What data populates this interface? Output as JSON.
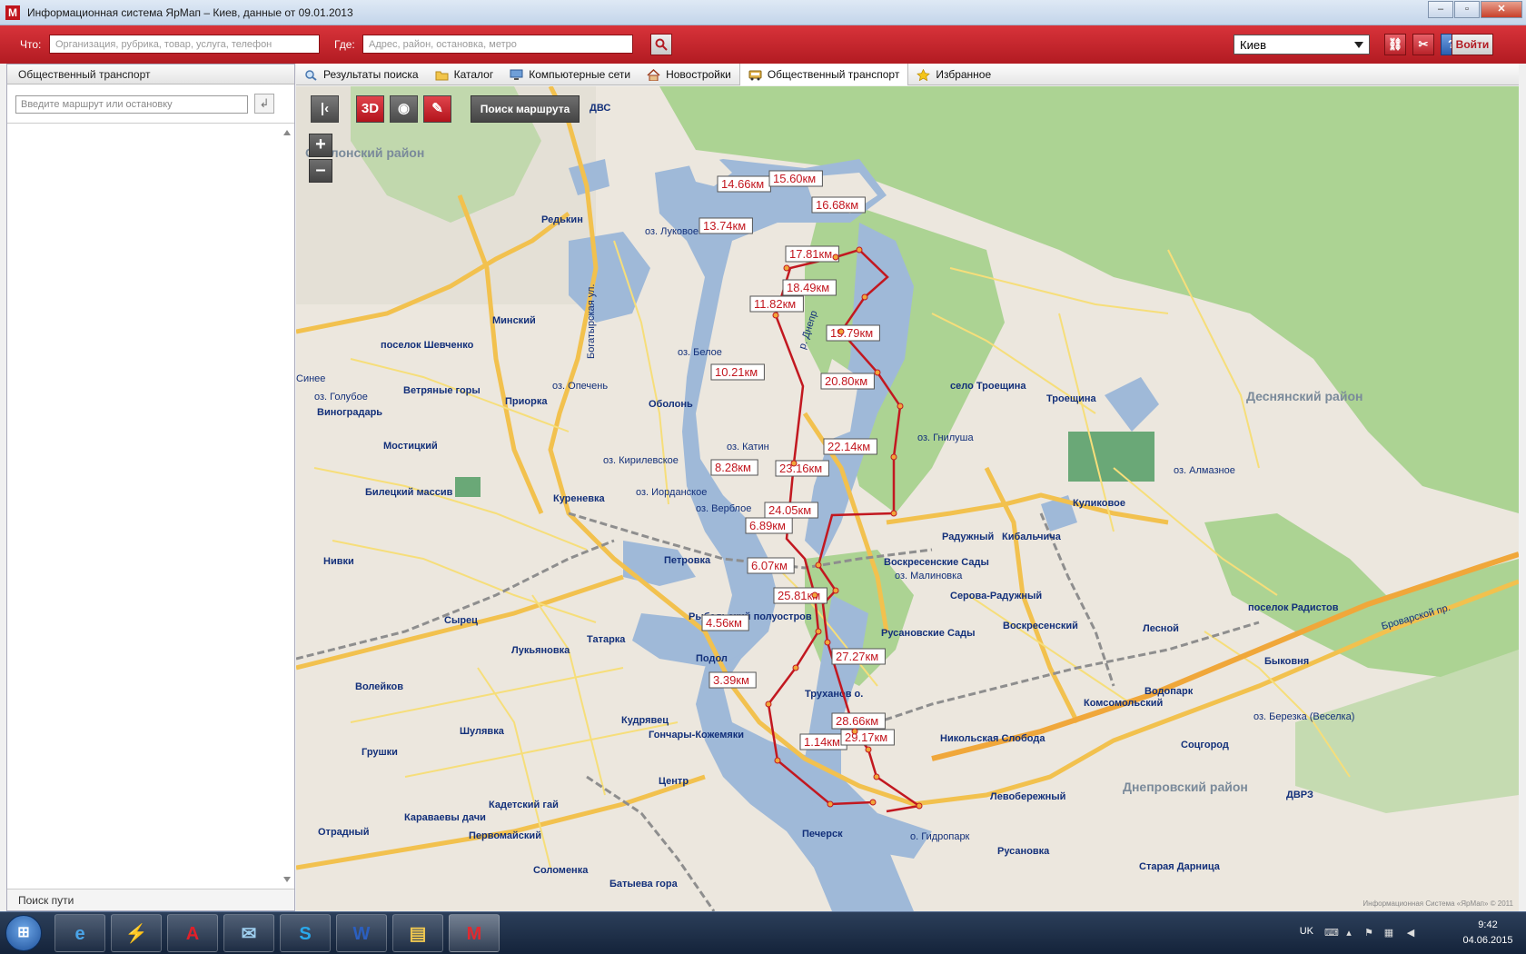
{
  "window": {
    "title": "Информационная система ЯрМап – Киев, данные от 09.01.2013",
    "app_icon": "М",
    "minimize": "–",
    "maximize": "▫",
    "close": "✕"
  },
  "searchbar": {
    "what_label": "Что:",
    "what_placeholder": "Организация, рубрика, товар, услуга, телефон",
    "where_label": "Где:",
    "where_placeholder": "Адрес, район, остановка, метро",
    "city": "Киев",
    "login": "Войти"
  },
  "leftpanel": {
    "header": "Общественный транспорт",
    "search_placeholder": "Введите маршрут или остановку",
    "footer": "Поиск пути"
  },
  "tabs": [
    {
      "label": "Результаты поиска",
      "icon": "search-results-icon"
    },
    {
      "label": "Каталог",
      "icon": "folder-icon"
    },
    {
      "label": "Компьютерные сети",
      "icon": "computer-icon"
    },
    {
      "label": "Новостройки",
      "icon": "house-icon"
    },
    {
      "label": "Общественный транспорт",
      "icon": "bus-icon",
      "active": true
    },
    {
      "label": "Избранное",
      "icon": "star-icon"
    }
  ],
  "map": {
    "toolbar": {
      "route_search": "Поиск маршрута",
      "three_d": "3D"
    },
    "zoom_in": "+",
    "zoom_out": "–",
    "copyright": "Информационная Система «ЯрМап» © 2011",
    "districts": [
      "Оболонский район",
      "Деснянский район",
      "Днепровский район"
    ],
    "places": [
      "ДВС",
      "Редькин",
      "оз. Луковое",
      "Минский",
      "поселок Шевченко",
      "Синее",
      "оз. Голубое",
      "Виноградарь",
      "Ветряные горы",
      "Приорка",
      "оз. Опечень",
      "Оболонь",
      "оз. Белое",
      "Мостицкий",
      "оз. Кирилевское",
      "Билецкий массив",
      "Куреневка",
      "оз. Иорданское",
      "оз. Верблое",
      "Петровка",
      "Нивки",
      "Сырец",
      "Лукьяновка",
      "Татарка",
      "Подол",
      "Рыбальский полуостров",
      "Волейков",
      "Кудрявец",
      "Гончары-Кожемяки",
      "Шулявка",
      "Грушки",
      "Центр",
      "Кадетский гай",
      "Караваевы дачи",
      "Первомайский",
      "Отрадный",
      "Соломенка",
      "Батыева гора",
      "Печерск",
      "Труханов о.",
      "оз. Катин",
      "оз. Гнилуша",
      "село Троещина",
      "Троещина",
      "оз. Алмазное",
      "Куликовое",
      "Радужный",
      "Кибальчича",
      "Воскресенские Сады",
      "оз. Малиновка",
      "Серова-Радужный",
      "Воскресенский",
      "Русановские Сады",
      "Лесной",
      "поселок Радистов",
      "Быковня",
      "Водопарк",
      "Комсомольский",
      "оз. Березка (Веселка)",
      "Никольская Слобода",
      "Соцгород",
      "ДВРЗ",
      "Левобережный",
      "о. Гидропарк",
      "Русановка",
      "Старая Дарница",
      "Броварской пр.",
      "р. Днепр",
      "Богатырская ул."
    ],
    "route_labels": [
      "1.14км",
      "3.39км",
      "4.56км",
      "6.07км",
      "6.89км",
      "8.28км",
      "10.21км",
      "11.82км",
      "13.74км",
      "14.66км",
      "15.60км",
      "16.68км",
      "17.81км",
      "18.49км",
      "19.79км",
      "20.80км",
      "22.14км",
      "23.16км",
      "24.05км",
      "25.81км",
      "27.27км",
      "28.66км",
      "29.17км"
    ],
    "route_color": "#c21820",
    "water_color": "#9fb9d8",
    "park_color": "#a9d28f"
  },
  "taskbar": {
    "start_icon": "windows-orb-icon",
    "lang": "UK",
    "time": "9:42",
    "date": "04.06.2015"
  }
}
